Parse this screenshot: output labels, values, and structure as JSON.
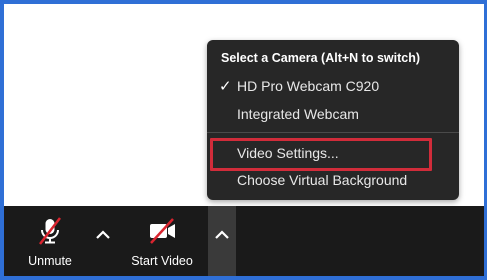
{
  "camera_menu": {
    "header": "Select a Camera (Alt+N to switch)",
    "items": [
      {
        "label": "HD Pro Webcam C920",
        "selected": true
      },
      {
        "label": "Integrated Webcam",
        "selected": false
      }
    ],
    "settings": [
      {
        "label": "Video Settings...",
        "highlighted": true
      },
      {
        "label": "Choose Virtual Background"
      }
    ],
    "check_glyph": "✓"
  },
  "toolbar": {
    "unmute_label": "Unmute",
    "start_video_label": "Start Video",
    "unmute_icon": "muted-microphone-icon",
    "video_icon": "video-off-camera-icon",
    "audio_caret_icon": "chevron-up-icon",
    "video_caret_icon": "chevron-up-icon"
  },
  "colors": {
    "frame_border": "#2f6fd6",
    "menu_background": "#272727",
    "toolbar_background": "#1a1a1a",
    "highlight": "#d12c3a",
    "mute_slash": "#d9242f"
  }
}
